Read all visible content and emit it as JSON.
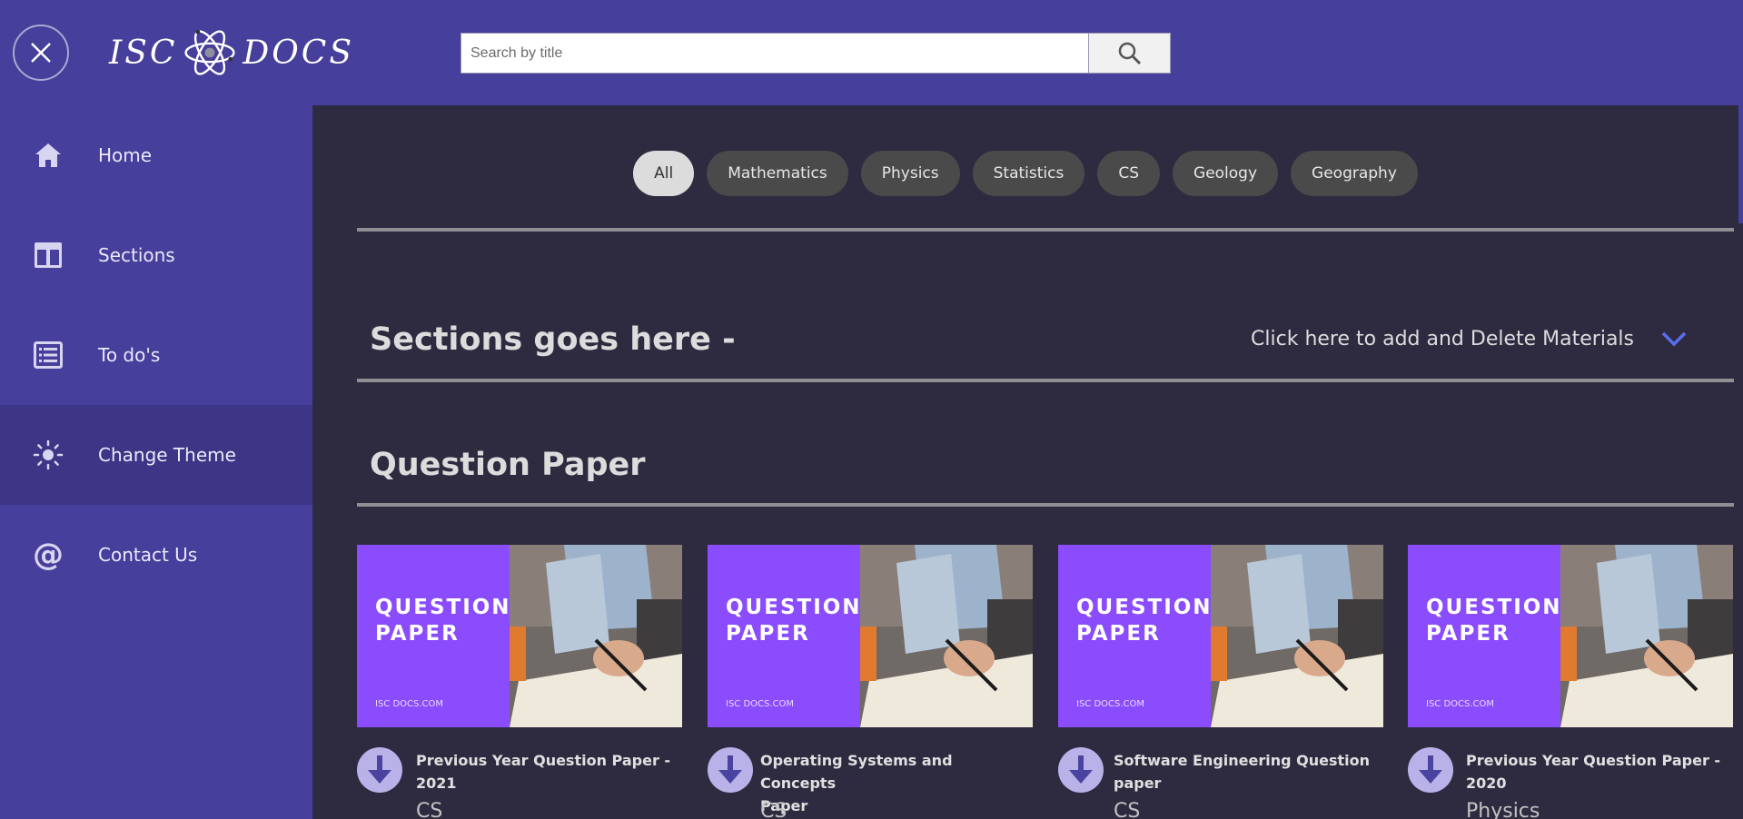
{
  "header": {
    "logo_left": "ISC",
    "logo_right": "DOCS",
    "search_placeholder": "Search by title",
    "close_icon": "close-icon",
    "search_icon": "search-icon"
  },
  "sidebar": {
    "items": [
      {
        "label": "Home",
        "icon": "home-icon"
      },
      {
        "label": "Sections",
        "icon": "sections-icon"
      },
      {
        "label": "To do's",
        "icon": "list-icon"
      },
      {
        "label": "Change Theme",
        "icon": "sun-icon"
      },
      {
        "label": "Contact Us",
        "icon": "at-icon"
      }
    ]
  },
  "filters": {
    "chips": [
      "All",
      "Mathematics",
      "Physics",
      "Statistics",
      "CS",
      "Geology",
      "Geography"
    ],
    "active": "All"
  },
  "sections_header": {
    "title": "Sections goes here -",
    "action": "Click here to add and Delete Materials"
  },
  "question_paper": {
    "title": "Question Paper",
    "thumb_title_line1": "QUESTION",
    "thumb_title_line2": "PAPER",
    "thumb_sub": "ISC DOCS.COM",
    "cards": [
      {
        "title_line1": "Previous Year Question Paper -",
        "title_line2": "2021",
        "category": "CS"
      },
      {
        "title_line1": "Operating Systems and Concepts",
        "title_line2": "Paper",
        "category": "CS"
      },
      {
        "title_line1": "Software Engineering Question",
        "title_line2": "paper",
        "category": "CS"
      },
      {
        "title_line1": "Previous Year Question Paper -",
        "title_line2": "2020",
        "category": "Physics"
      }
    ]
  },
  "colors": {
    "header_bg": "#463f9b",
    "main_bg": "#2e2b40",
    "thumb_purple": "#8a4cfc",
    "accent_blue": "#5b6cf0"
  }
}
